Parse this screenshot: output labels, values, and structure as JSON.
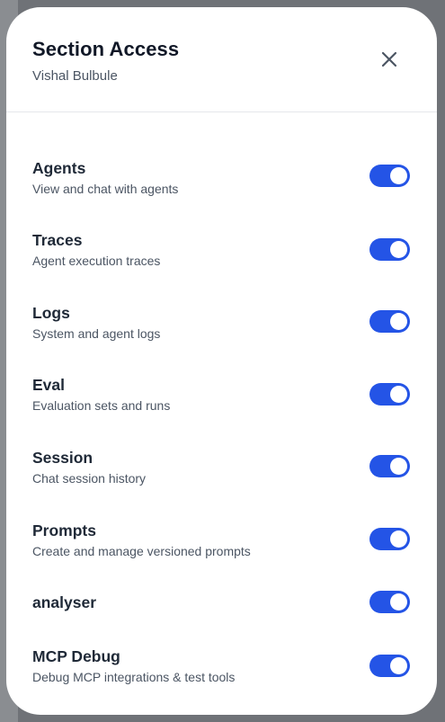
{
  "modal": {
    "title": "Section Access",
    "subtitle": "Vishal Bulbule"
  },
  "sections": [
    {
      "label": "Agents",
      "description": "View and chat with agents",
      "enabled": true
    },
    {
      "label": "Traces",
      "description": "Agent execution traces",
      "enabled": true
    },
    {
      "label": "Logs",
      "description": "System and agent logs",
      "enabled": true
    },
    {
      "label": "Eval",
      "description": "Evaluation sets and runs",
      "enabled": true
    },
    {
      "label": "Session",
      "description": "Chat session history",
      "enabled": true
    },
    {
      "label": "Prompts",
      "description": "Create and manage versioned prompts",
      "enabled": true
    },
    {
      "label": "analyser",
      "description": "",
      "enabled": true
    },
    {
      "label": "MCP Debug",
      "description": "Debug MCP integrations & test tools",
      "enabled": true
    }
  ],
  "colors": {
    "toggle_on": "#2454e6",
    "title": "#111827",
    "muted": "#4b5563"
  }
}
